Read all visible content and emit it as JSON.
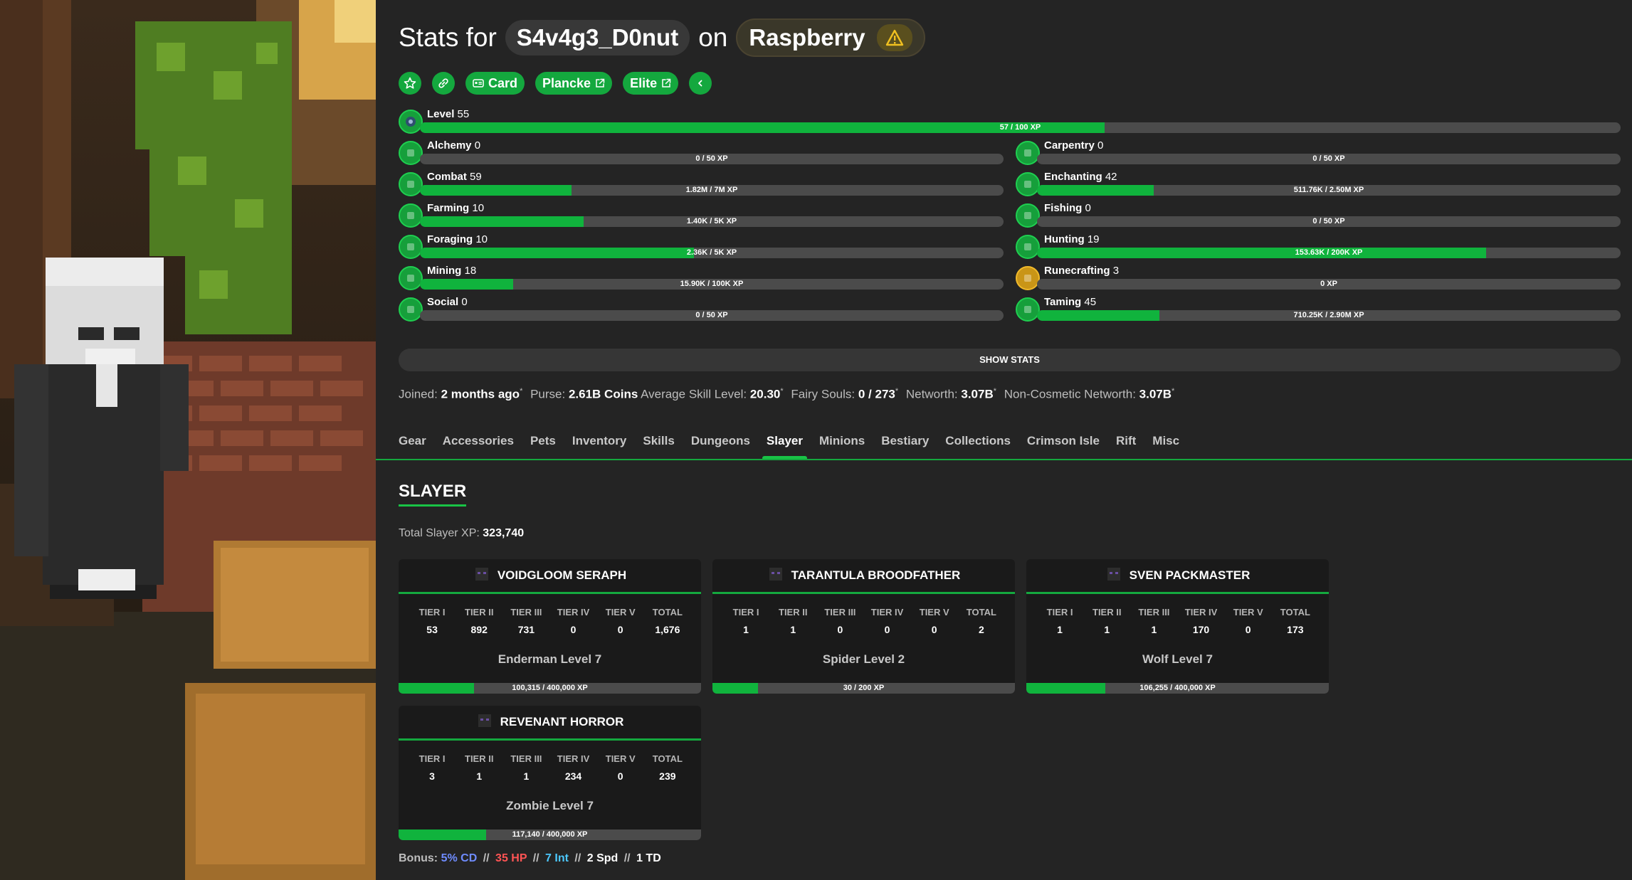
{
  "header": {
    "stats_for": "Stats for",
    "username": "S4v4g3_D0nut",
    "on": "on",
    "profile": "Raspberry"
  },
  "buttons": {
    "card": "Card",
    "plancke": "Plancke",
    "elite": "Elite"
  },
  "level": {
    "name": "Level",
    "level": "55",
    "xp": "57 / 100 XP",
    "progress": 0.57
  },
  "skills": [
    {
      "name": "Alchemy",
      "level": "0",
      "xp": "0 / 50 XP",
      "progress": 0,
      "icon": "potion-icon"
    },
    {
      "name": "Carpentry",
      "level": "0",
      "xp": "0 / 50 XP",
      "progress": 0,
      "icon": "crafting-table-icon"
    },
    {
      "name": "Combat",
      "level": "59",
      "xp": "1.82M / 7M XP",
      "progress": 0.26,
      "icon": "sword-icon"
    },
    {
      "name": "Enchanting",
      "level": "42",
      "xp": "511.76K / 2.50M XP",
      "progress": 0.2,
      "icon": "enchanting-table-icon"
    },
    {
      "name": "Farming",
      "level": "10",
      "xp": "1.40K / 5K XP",
      "progress": 0.28,
      "icon": "hoe-icon"
    },
    {
      "name": "Fishing",
      "level": "0",
      "xp": "0 / 50 XP",
      "progress": 0,
      "icon": "fishing-rod-icon"
    },
    {
      "name": "Foraging",
      "level": "10",
      "xp": "2.36K / 5K XP",
      "progress": 0.47,
      "icon": "sapling-icon"
    },
    {
      "name": "Hunting",
      "level": "19",
      "xp": "153.63K / 200K XP",
      "progress": 0.77,
      "icon": "lead-icon"
    },
    {
      "name": "Mining",
      "level": "18",
      "xp": "15.90K / 100K XP",
      "progress": 0.16,
      "icon": "pickaxe-icon"
    },
    {
      "name": "Runecrafting",
      "level": "3",
      "xp": "0 XP",
      "progress": 0,
      "icon": "magma-cream-icon"
    },
    {
      "name": "Social",
      "level": "0",
      "xp": "0 / 50 XP",
      "progress": 0,
      "icon": "emerald-icon"
    },
    {
      "name": "Taming",
      "level": "45",
      "xp": "710.25K / 2.90M XP",
      "progress": 0.21,
      "icon": "spawn-egg-icon"
    }
  ],
  "show_stats": "SHOW STATS",
  "info": {
    "joined_label": "Joined:",
    "joined": "2 months ago",
    "purse_label": "Purse:",
    "purse": "2.61B Coins",
    "avg_label": "Average Skill Level:",
    "avg": "20.30",
    "souls_label": "Fairy Souls:",
    "souls": "0 / 273",
    "nw_label": "Networth:",
    "nw": "3.07B",
    "ncnw_label": "Non-Cosmetic Networth:",
    "ncnw": "3.07B",
    "star": "*"
  },
  "tabs": [
    "Gear",
    "Accessories",
    "Pets",
    "Inventory",
    "Skills",
    "Dungeons",
    "Slayer",
    "Minions",
    "Bestiary",
    "Collections",
    "Crimson Isle",
    "Rift",
    "Misc"
  ],
  "active_tab": "Slayer",
  "slayer": {
    "heading": "SLAYER",
    "total_label": "Total Slayer XP:",
    "total": "323,740",
    "tier_headers": [
      "TIER I",
      "TIER II",
      "TIER III",
      "TIER IV",
      "TIER V",
      "TOTAL"
    ],
    "bosses": [
      {
        "name": "VOIDGLOOM SERAPH",
        "tiers": [
          "53",
          "892",
          "731",
          "0",
          "0",
          "1,676"
        ],
        "level": "Enderman Level 7",
        "xp": "100,315 / 400,000 XP",
        "progress": 0.25,
        "icon": "enderman-head-icon"
      },
      {
        "name": "TARANTULA BROODFATHER",
        "tiers": [
          "1",
          "1",
          "0",
          "0",
          "0",
          "2"
        ],
        "level": "Spider Level 2",
        "xp": "30 / 200 XP",
        "progress": 0.15,
        "icon": "spider-head-icon"
      },
      {
        "name": "SVEN PACKMASTER",
        "tiers": [
          "1",
          "1",
          "1",
          "170",
          "0",
          "173"
        ],
        "level": "Wolf Level 7",
        "xp": "106,255 / 400,000 XP",
        "progress": 0.26,
        "icon": "wolf-head-icon"
      },
      {
        "name": "REVENANT HORROR",
        "tiers": [
          "3",
          "1",
          "1",
          "234",
          "0",
          "239"
        ],
        "level": "Zombie Level 7",
        "xp": "117,140 / 400,000 XP",
        "progress": 0.29,
        "icon": "zombie-head-icon"
      }
    ]
  },
  "bonus": {
    "label": "Bonus:",
    "cd": "5% CD",
    "hp": "35 HP",
    "int": "7 Int",
    "spd": "2 Spd",
    "td": "1 TD",
    "sep": "//"
  }
}
